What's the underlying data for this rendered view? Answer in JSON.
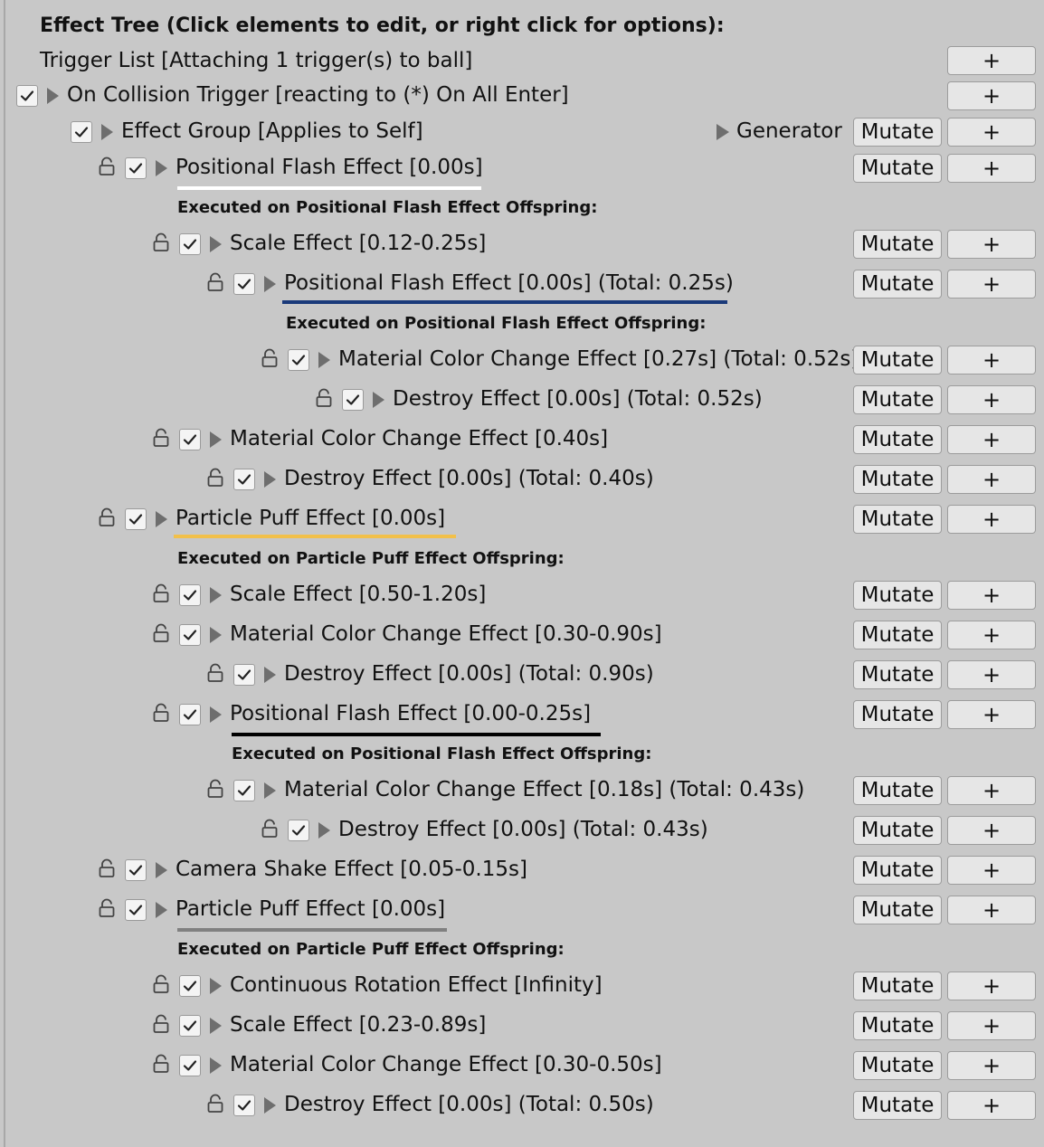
{
  "header": {
    "title": "Effect Tree (Click elements to edit, or right click for options):",
    "trigger_list": "Trigger List [Attaching 1 trigger(s) to ball]"
  },
  "buttons": {
    "mutate": "Mutate",
    "add": "+"
  },
  "generator_label": "Generator",
  "underline_colors": [
    "#ffffff",
    "#1a3a7a",
    "#f2c04a",
    "#000000",
    "#808080"
  ],
  "rows": [
    {
      "type": "trigger",
      "label": "On Collision Trigger [reacting to (*) On All Enter]",
      "checked": true
    },
    {
      "type": "group",
      "label": "Effect Group  [Applies to Self]",
      "checked": true
    },
    {
      "type": "effect",
      "label": "Positional Flash Effect [0.00s]",
      "checked": true,
      "underline_color": "#ffffff"
    },
    {
      "type": "offspring",
      "label": "Executed on Positional Flash Effect Offspring:"
    },
    {
      "type": "effect",
      "label": "Scale Effect [0.12-0.25s]",
      "checked": true
    },
    {
      "type": "effect",
      "label": "Positional Flash Effect [0.00s] (Total: 0.25s)",
      "checked": true,
      "underline_color": "#1a3a7a"
    },
    {
      "type": "offspring",
      "label": "Executed on Positional Flash Effect Offspring:"
    },
    {
      "type": "effect",
      "label": "Material Color Change Effect [0.27s] (Total: 0.52s)",
      "checked": true
    },
    {
      "type": "effect",
      "label": "Destroy Effect [0.00s] (Total: 0.52s)",
      "checked": true
    },
    {
      "type": "effect",
      "label": "Material Color Change Effect [0.40s]",
      "checked": true
    },
    {
      "type": "effect",
      "label": "Destroy Effect [0.00s] (Total: 0.40s)",
      "checked": true
    },
    {
      "type": "effect",
      "label": "Particle Puff Effect [0.00s]",
      "checked": true,
      "underline_color": "#f2c04a"
    },
    {
      "type": "offspring",
      "label": "Executed on Particle Puff Effect Offspring:"
    },
    {
      "type": "effect",
      "label": "Scale Effect [0.50-1.20s]",
      "checked": true
    },
    {
      "type": "effect",
      "label": "Material Color Change Effect [0.30-0.90s]",
      "checked": true
    },
    {
      "type": "effect",
      "label": "Destroy Effect [0.00s] (Total: 0.90s)",
      "checked": true
    },
    {
      "type": "effect",
      "label": "Positional Flash Effect [0.00-0.25s]",
      "checked": true,
      "underline_color": "#000000"
    },
    {
      "type": "offspring",
      "label": "Executed on Positional Flash Effect Offspring:"
    },
    {
      "type": "effect",
      "label": "Material Color Change Effect [0.18s] (Total: 0.43s)",
      "checked": true
    },
    {
      "type": "effect",
      "label": "Destroy Effect [0.00s] (Total: 0.43s)",
      "checked": true
    },
    {
      "type": "effect",
      "label": "Camera Shake Effect [0.05-0.15s]",
      "checked": true
    },
    {
      "type": "effect",
      "label": "Particle Puff Effect [0.00s]",
      "checked": true,
      "underline_color": "#808080"
    },
    {
      "type": "offspring",
      "label": "Executed on Particle Puff Effect Offspring:"
    },
    {
      "type": "effect",
      "label": "Continuous Rotation Effect [Infinity]",
      "checked": true
    },
    {
      "type": "effect",
      "label": "Scale Effect [0.23-0.89s]",
      "checked": true
    },
    {
      "type": "effect",
      "label": "Material Color Change Effect [0.30-0.50s]",
      "checked": true
    },
    {
      "type": "effect",
      "label": "Destroy Effect [0.00s] (Total: 0.50s)",
      "checked": true
    }
  ]
}
